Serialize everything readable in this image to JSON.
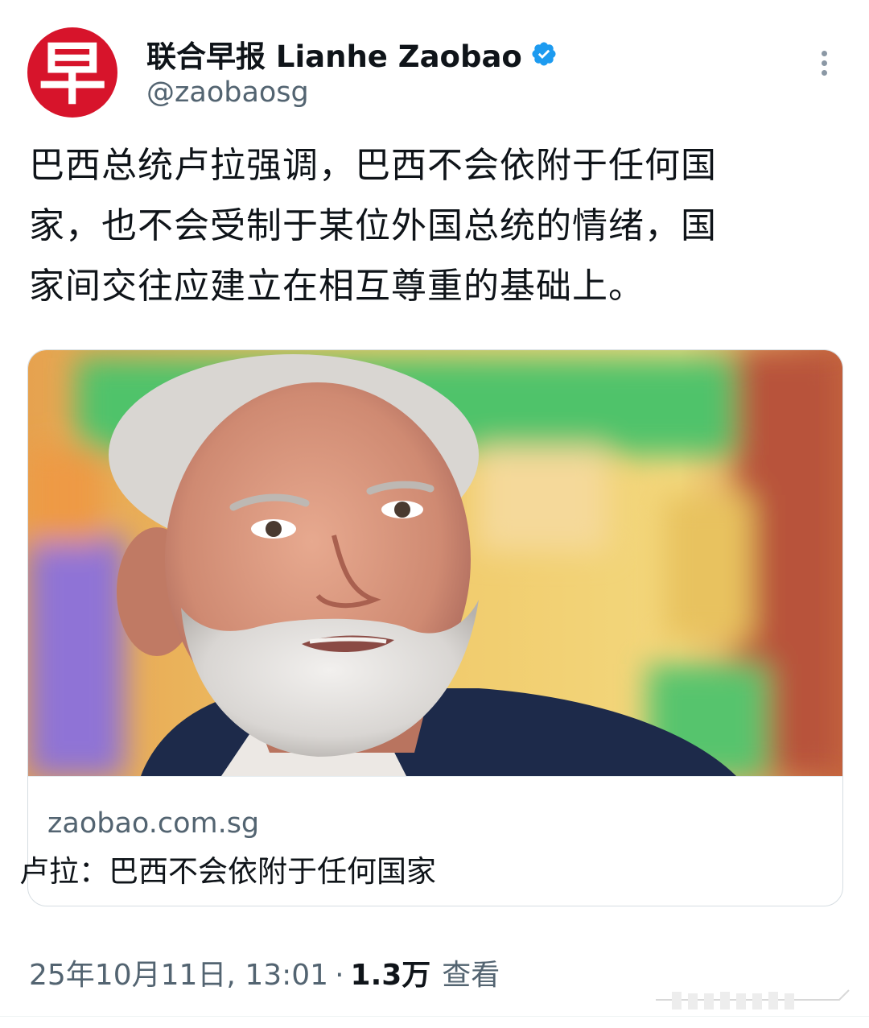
{
  "account": {
    "display_name": "联合早报 Lianhe Zaobao",
    "handle": "@zaobaosg",
    "avatar_glyph": "早",
    "avatar_color": "#d7142b",
    "verified_color": "#1d9bf0"
  },
  "tweet": {
    "text_lines": [
      "巴西总统卢拉强调，巴西不会依附于任何国",
      "家，也不会受制于某位外国总统的情绪，国",
      "家间交往应建立在相互尊重的基础上。"
    ]
  },
  "link_card": {
    "domain": "zaobao.com.sg",
    "title": "卢拉：巴西不会依附于任何国家",
    "image_description_icon": "photo"
  },
  "meta": {
    "timestamp": "25年10月11日, 13:01",
    "separator": "·",
    "views_count": "1.3万",
    "views_label": "查看"
  },
  "icons": {
    "more": "more-vertical-icon",
    "verified": "verified-badge-icon"
  }
}
